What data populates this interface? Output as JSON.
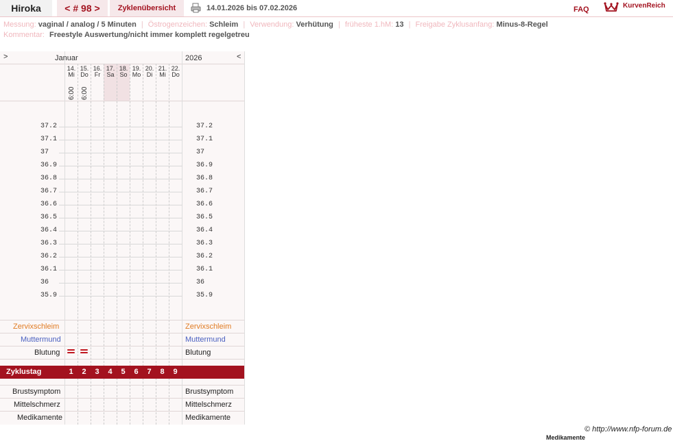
{
  "header": {
    "user": "Hiroka",
    "nav_prev": "<",
    "cycle_no": "# 98",
    "nav_next": ">",
    "tab": "Zyklenübersicht",
    "date_range": "14.01.2026 bis 07.02.2026",
    "faq": "FAQ",
    "logo": "KurvenReich",
    "icons": {
      "print": "printer-icon",
      "logo": "crown-icon"
    }
  },
  "info": {
    "messung_label": "Messung:",
    "messung": "vaginal / analog / 5 Minuten",
    "oestrogen_label": "Östrogenzeichen:",
    "oestrogen": "Schleim",
    "verwendung_label": "Verwendung:",
    "verwendung": "Verhütung",
    "frueheste_label": "früheste 1.hM:",
    "frueheste": "13",
    "freigabe_label": "Freigabe Zyklusanfang:",
    "freigabe": "Minus-8-Regel",
    "kommentar_label": "Kommentar:",
    "kommentar": "Freestyle Auswertung/nicht immer komplett regelgetreu"
  },
  "chart": {
    "nav_left": ">",
    "month": "Januar",
    "year": "2026",
    "nav_right": "<",
    "days": [
      {
        "d": "14.",
        "w": "Mi",
        "time": "6:00",
        "bleed": true,
        "weekend": false
      },
      {
        "d": "15.",
        "w": "Do",
        "time": "6:00",
        "bleed": true,
        "weekend": false
      },
      {
        "d": "16.",
        "w": "Fr",
        "time": "",
        "bleed": false,
        "weekend": false
      },
      {
        "d": "17.",
        "w": "Sa",
        "time": "",
        "bleed": false,
        "weekend": true
      },
      {
        "d": "18.",
        "w": "So",
        "time": "",
        "bleed": false,
        "weekend": true
      },
      {
        "d": "19.",
        "w": "Mo",
        "time": "",
        "bleed": false,
        "weekend": false
      },
      {
        "d": "20.",
        "w": "Di",
        "time": "",
        "bleed": false,
        "weekend": false
      },
      {
        "d": "21.",
        "w": "Mi",
        "time": "",
        "bleed": false,
        "weekend": false
      },
      {
        "d": "22.",
        "w": "Do",
        "time": "",
        "bleed": false,
        "weekend": false
      }
    ],
    "temps": [
      "37.2",
      "37.1",
      "37",
      "36.9",
      "36.8",
      "36.7",
      "36.6",
      "36.5",
      "36.4",
      "36.3",
      "36.2",
      "36.1",
      "36",
      "35.9"
    ],
    "rows": {
      "zervix": "Zervixschleim",
      "muttermund": "Muttermund",
      "blutung": "Blutung",
      "zyklustag": "Zyklustag",
      "brust": "Brustsymptom",
      "mittel": "Mittelschmerz",
      "medi": "Medikamente"
    },
    "cycle_days": [
      "1",
      "2",
      "3",
      "4",
      "5",
      "6",
      "7",
      "8",
      "9"
    ],
    "colors": {
      "zervix": "#e07b22",
      "muttermund": "#4a60c0",
      "accent": "#a3121f"
    }
  },
  "footer": {
    "copyright": "© http://www.nfp-forum.de",
    "cut_label": "Medikamente"
  }
}
